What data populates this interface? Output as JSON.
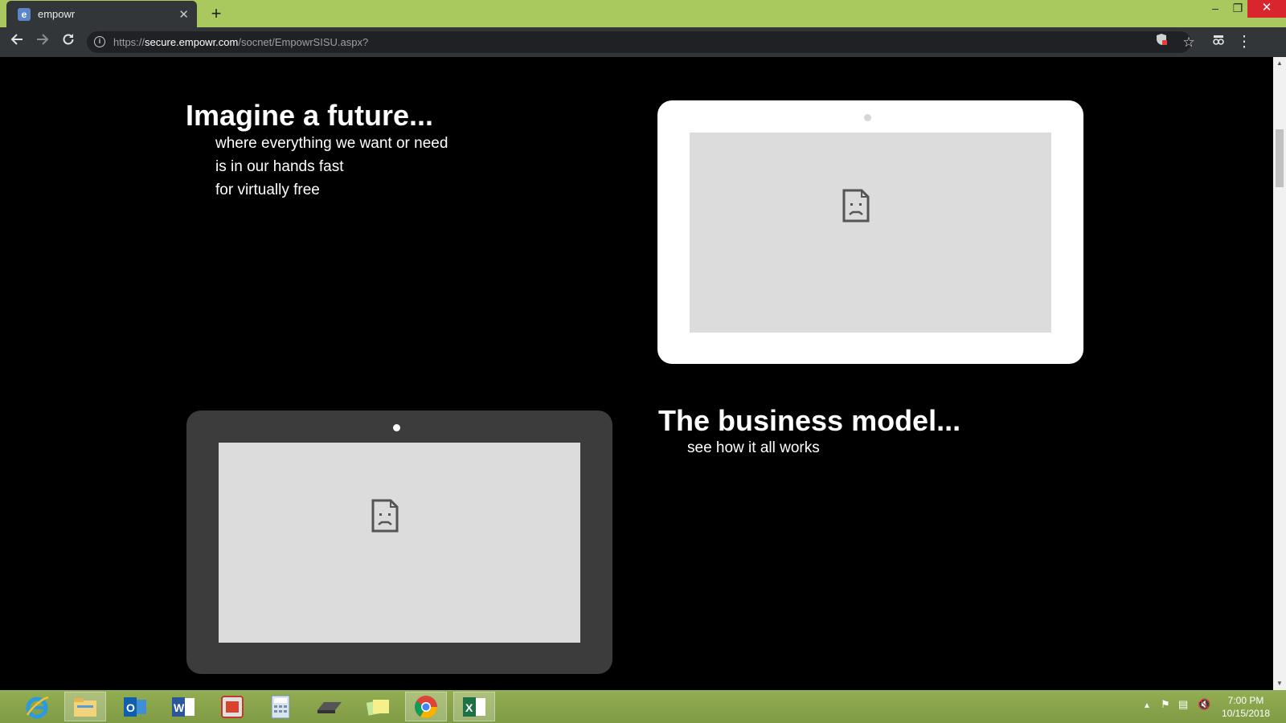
{
  "browser": {
    "tab": {
      "title": "empowr",
      "favicon_letter": "e"
    },
    "url": {
      "scheme": "https://",
      "host": "secure.empowr.com",
      "path": "/socnet/EmpowrSISU.aspx?"
    }
  },
  "page": {
    "section1": {
      "title": "Imagine a future...",
      "lines": [
        "where everything we want or need",
        "is in our hands fast",
        "for virtually free"
      ]
    },
    "section2": {
      "title": "The business model...",
      "subtitle": "see how it all works"
    }
  },
  "taskbar": {
    "apps": [
      "internet-explorer",
      "file-explorer",
      "outlook",
      "word",
      "acrobat",
      "calculator",
      "scanner",
      "sticky-notes",
      "chrome",
      "excel"
    ],
    "clock": {
      "time": "7:00 PM",
      "date": "10/15/2018"
    }
  },
  "colors": {
    "titlebar": "#a9c95f",
    "toolbar": "#323639",
    "page_bg": "#000000",
    "taskbar": "#8aa64c"
  }
}
